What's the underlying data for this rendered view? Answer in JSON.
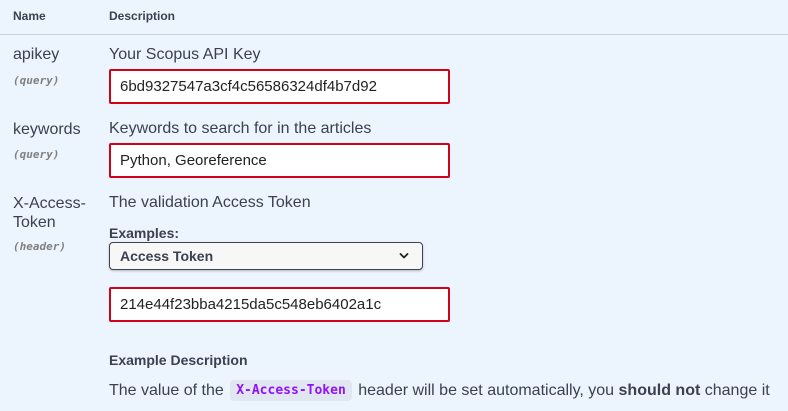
{
  "table": {
    "name_header": "Name",
    "description_header": "Description"
  },
  "params": [
    {
      "name": "apikey",
      "location": "(query)",
      "description": "Your Scopus API Key",
      "value": "6bd9327547a3cf4c56586324df4b7d92"
    },
    {
      "name": "keywords",
      "location": "(query)",
      "description": "Keywords to search for in the articles",
      "value": "Python, Georeference"
    },
    {
      "name_line1": "X-Access-",
      "name_line2": "Token",
      "location": "(header)",
      "description": "The validation Access Token",
      "examples_label": "Examples:",
      "example_selected": "Access Token",
      "value": "214e44f23bba4215da5c548eb6402a1c",
      "example_description_title": "Example Description",
      "example_description": {
        "before": "The value of the",
        "code": "X-Access-Token",
        "middle": "header will be set automatically, you",
        "bold": "should not",
        "after": "change it"
      }
    }
  ],
  "colors": {
    "background": "#ecf4fd",
    "invalid_border": "#d0021b",
    "code_text": "#9012fe"
  },
  "icons": {
    "select_arrow": "chevron-down-icon"
  }
}
